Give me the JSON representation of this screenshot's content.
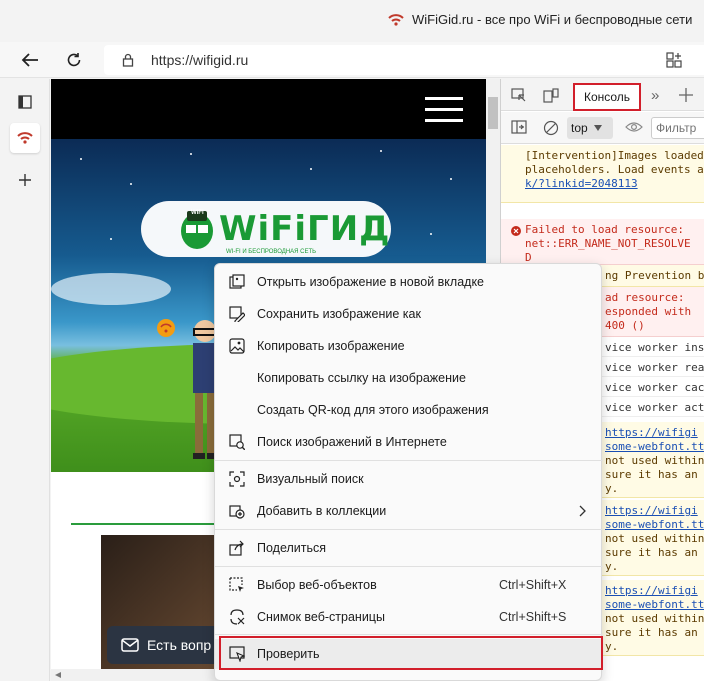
{
  "window": {
    "title": "WiFiGid.ru - все про WiFi и беспроводные сети"
  },
  "address_bar": {
    "url": "https://wifigid.ru"
  },
  "site": {
    "logo_main": "WiFiГИД",
    "logo_badge": "WiFi",
    "logo_sub": "WI-FI И БЕСПРОВОДНАЯ СЕТЬ",
    "chat_label": "Есть вопр"
  },
  "devtools": {
    "console_tab": "Консоль",
    "context_select": "top",
    "filter_placeholder": "Фильтр",
    "logs": [
      {
        "type": "warn",
        "lines": [
          "[Intervention]Images loaded",
          "placeholders. Load events a",
          "k/?linkid=2048113"
        ]
      },
      {
        "type": "err",
        "lines": [
          "Failed to load resource:",
          "net::ERR_NAME_NOT_RESOLVE",
          "D"
        ]
      },
      {
        "type": "warn",
        "lines": [
          "ng Prevention bl"
        ]
      },
      {
        "type": "err",
        "lines": [
          "ad resource:",
          "esponded with",
          "400 ()"
        ]
      },
      {
        "type": "info",
        "lines": [
          "vice worker ins"
        ]
      },
      {
        "type": "info",
        "lines": [
          "vice worker rea"
        ]
      },
      {
        "type": "info",
        "lines": [
          "vice worker cac"
        ]
      },
      {
        "type": "info",
        "lines": [
          "vice worker act"
        ]
      },
      {
        "type": "warn",
        "lines": [
          "https://wifigi",
          "some-webfont.tt",
          "not used within",
          "sure it has an",
          "y."
        ]
      },
      {
        "type": "warn",
        "lines": [
          "https://wifigi",
          "some-webfont.tt",
          "not used within",
          "sure it has an",
          "y."
        ]
      },
      {
        "type": "warn",
        "lines": [
          "https://wifigi",
          "some-webfont.tt",
          "not used within",
          "sure it has an",
          "y."
        ]
      }
    ]
  },
  "context_menu": {
    "items": [
      {
        "label": "Открыть изображение в новой вкладке",
        "icon": "open-new-tab-icon"
      },
      {
        "label": "Сохранить изображение как",
        "icon": "save-image-icon"
      },
      {
        "label": "Копировать изображение",
        "icon": "copy-image-icon"
      },
      {
        "label": "Копировать ссылку на изображение",
        "icon": ""
      },
      {
        "label": "Создать QR-код для этого изображения",
        "icon": ""
      },
      {
        "label": "Поиск изображений в Интернете",
        "icon": "image-search-icon"
      },
      {
        "label": "Визуальный поиск",
        "icon": "visual-search-icon"
      },
      {
        "label": "Добавить в коллекции",
        "icon": "collections-icon"
      },
      {
        "label": "Поделиться",
        "icon": "share-icon"
      },
      {
        "label": "Выбор веб-объектов",
        "icon": "web-select-icon",
        "shortcut": "Ctrl+Shift+X"
      },
      {
        "label": "Снимок веб-страницы",
        "icon": "web-capture-icon",
        "shortcut": "Ctrl+Shift+S"
      },
      {
        "label": "Проверить",
        "icon": "inspect-icon"
      }
    ]
  },
  "colors": {
    "accent_red": "#d21f2b",
    "site_green": "#1a9a35",
    "wifi_red": "#c0392b"
  }
}
